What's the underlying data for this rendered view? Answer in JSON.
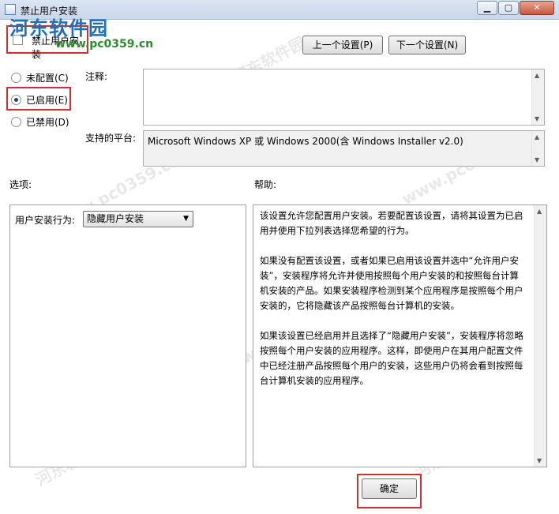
{
  "window": {
    "title": "禁止用户安装",
    "min": "▁",
    "max": "▢",
    "close": "✕"
  },
  "watermark": {
    "logo": "河东软件园",
    "url": "www.pc0359.cn"
  },
  "policy": {
    "name": "禁止用户安装"
  },
  "nav": {
    "prev": "上一个设置(P)",
    "next": "下一个设置(N)"
  },
  "state": {
    "not_configured": "未配置(C)",
    "enabled": "已启用(E)",
    "disabled": "已禁用(D)",
    "selected": "enabled"
  },
  "comment": {
    "label": "注释:",
    "value": ""
  },
  "platform": {
    "label": "支持的平台:",
    "value": "Microsoft Windows XP 或 Windows 2000(含 Windows Installer v2.0)"
  },
  "options": {
    "label": "选项:",
    "behavior_label": "用户安装行为:",
    "behavior_value": "隐藏用户安装"
  },
  "help": {
    "label": "帮助:",
    "paragraphs": [
      "该设置允许您配置用户安装。若要配置该设置，请将其设置为已启用并使用下拉列表选择您希望的行为。",
      "如果没有配置该设置，或者如果已启用该设置并选中“允许用户安装”，安装程序将允许并使用按照每个用户安装的和按照每台计算机安装的产品。如果安装程序检测到某个应用程序是按照每个用户安装的，它将隐藏该产品按照每台计算机的安装。",
      "如果该设置已经启用并且选择了“隐藏用户安装”，安装程序将忽略按照每个用户安装的应用程序。这样，即使用户在其用户配置文件中已经注册产品按照每个用户的安装，这些用户仍将会看到按照每台计算机安装的应用程序。"
    ]
  },
  "buttons": {
    "ok": "确定"
  },
  "colors": {
    "highlight": "#d03030",
    "titlebar": "#dbe6f3",
    "radio_dot": "#1e3f8a"
  }
}
